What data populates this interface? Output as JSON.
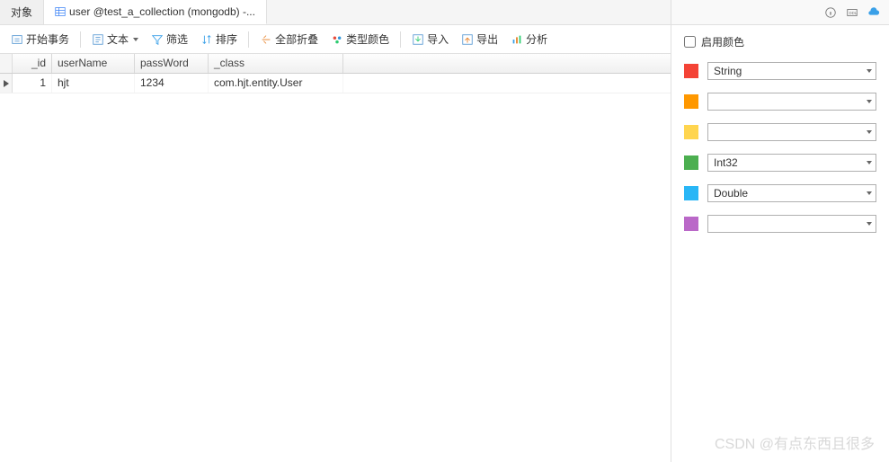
{
  "tabs": {
    "objects": "对象",
    "active": "user @test_a_collection (mongodb) -..."
  },
  "toolbar": {
    "begin_tx": "开始事务",
    "text": "文本",
    "filter": "筛选",
    "sort": "排序",
    "collapse_all": "全部折叠",
    "type_color": "类型颜色",
    "import": "导入",
    "export": "导出",
    "analyze": "分析"
  },
  "grid": {
    "columns": [
      "_id",
      "userName",
      "passWord",
      "_class"
    ],
    "rows": [
      {
        "_id": "1",
        "userName": "hjt",
        "passWord": "1234",
        "_class": "com.hjt.entity.User"
      }
    ]
  },
  "side": {
    "enable_color": "启用颜色",
    "colors": [
      {
        "hex": "#f44336",
        "label": "String"
      },
      {
        "hex": "#ff9800",
        "label": ""
      },
      {
        "hex": "#ffd54f",
        "label": ""
      },
      {
        "hex": "#4caf50",
        "label": "Int32"
      },
      {
        "hex": "#29b6f6",
        "label": "Double"
      },
      {
        "hex": "#ba68c8",
        "label": ""
      }
    ]
  },
  "watermark": "CSDN @有点东西且很多"
}
